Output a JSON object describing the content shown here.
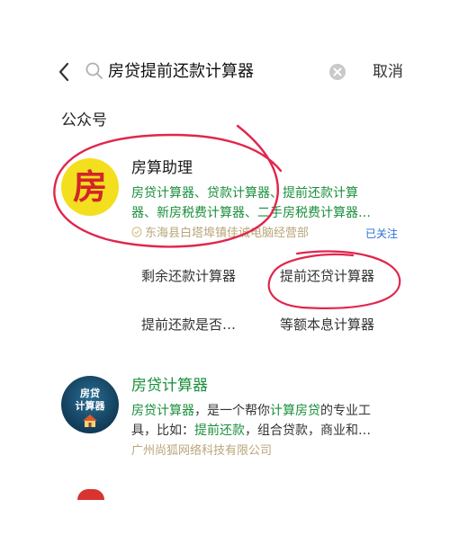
{
  "search": {
    "query": "房贷提前还款计算器",
    "cancel_label": "取消"
  },
  "section": {
    "title": "公众号"
  },
  "results": [
    {
      "avatar_text": "房",
      "name": "房算助理",
      "desc_line1": "房贷计算器、贷款计算器、提前还款计算",
      "desc_line2": "器、新房税费计算器、二手房税费计算器…",
      "owner": "东海县白塔埠镇佳诚电脑经营部",
      "followed": "已关注",
      "quick_links": [
        "剩余还款计算器",
        "提前还贷计算器",
        "提前还款是否…",
        "等额本息计算器"
      ]
    },
    {
      "avatar_line1": "房贷",
      "avatar_line2": "计算器",
      "name": "房贷计算器",
      "desc_parts": [
        "房贷计算器",
        "，是一个帮你",
        "计算房贷",
        "的专业工"
      ],
      "desc_line2_parts": [
        "具，比如：",
        "提前还款",
        "，组合贷款，商业和…"
      ],
      "owner": "广州尚狐网络科技有限公司"
    }
  ],
  "colors": {
    "highlight": "#1a8f3c",
    "owner": "#b9a57a",
    "followed": "#2d6fd0",
    "annotation": "#e0264d"
  },
  "icons": {
    "back": "chevron-left-icon",
    "search": "search-icon",
    "clear": "clear-icon",
    "verified": "verified-badge-icon"
  }
}
